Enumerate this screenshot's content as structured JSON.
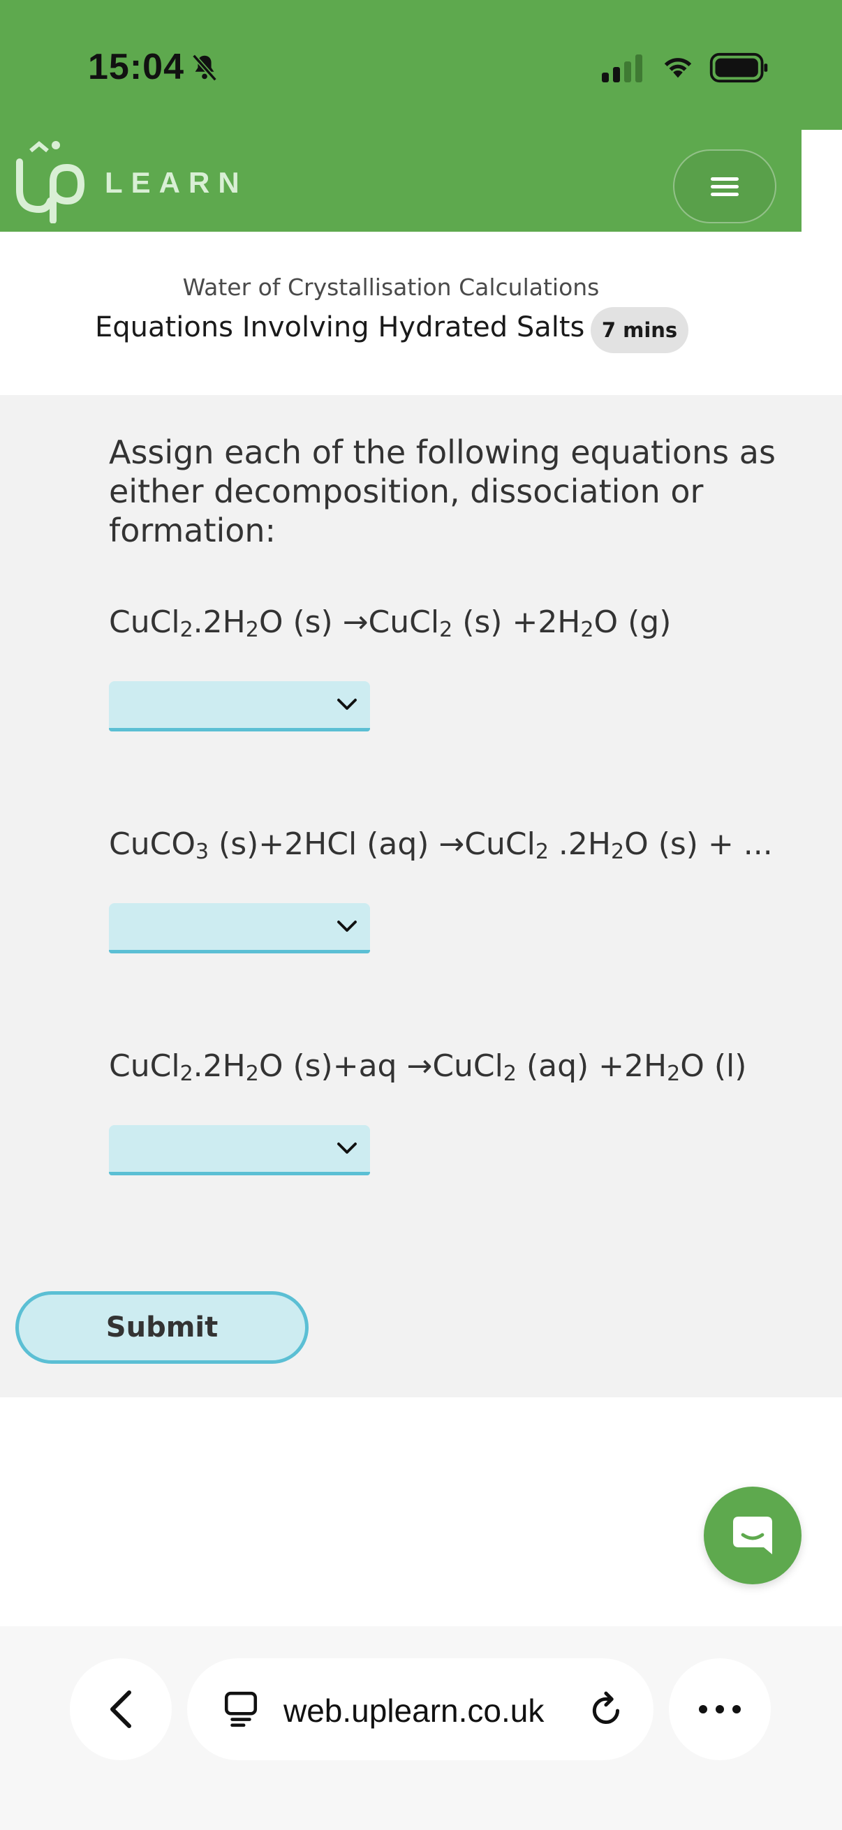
{
  "status_bar": {
    "time": "15:04"
  },
  "header": {
    "logo_text": "LEARN",
    "brand_color": "#5ea94e"
  },
  "lesson": {
    "subtitle": "Water of Crystallisation Calculations",
    "title": "Equations Involving Hydrated Salts",
    "duration": "7 mins"
  },
  "question": {
    "instruction": "Assign each of the following equations as either decomposition, dissociation or formation:",
    "equations": [
      {
        "parts": [
          "CuCl",
          "2",
          ".2H",
          "2",
          "O (s) →CuCl",
          "2",
          " (s) +2H",
          "2",
          "O (g)"
        ]
      },
      {
        "parts": [
          "CuCO",
          "3",
          " (s)+2HCl (aq) →CuCl",
          "2",
          " .2H",
          "2",
          "O (s) + ..."
        ]
      },
      {
        "parts": [
          "CuCl",
          "2",
          ".2H",
          "2",
          "O (s)+aq →CuCl",
          "2",
          " (aq) +2H",
          "2",
          "O (l)"
        ]
      }
    ],
    "dropdowns": [
      {
        "selected": ""
      },
      {
        "selected": ""
      },
      {
        "selected": ""
      }
    ],
    "submit_label": "Submit"
  },
  "browser": {
    "url": "web.uplearn.co.uk"
  },
  "icons": {
    "bell": "bell-slash-icon",
    "signal": "cellular-signal-icon",
    "wifi": "wifi-icon",
    "battery": "battery-icon",
    "menu": "hamburger-menu-icon",
    "chevron": "chevron-down-icon",
    "chat": "chat-bubble-icon",
    "back": "chevron-left-icon",
    "reader": "reader-mode-icon",
    "reload": "reload-icon",
    "more": "more-dots-icon"
  }
}
